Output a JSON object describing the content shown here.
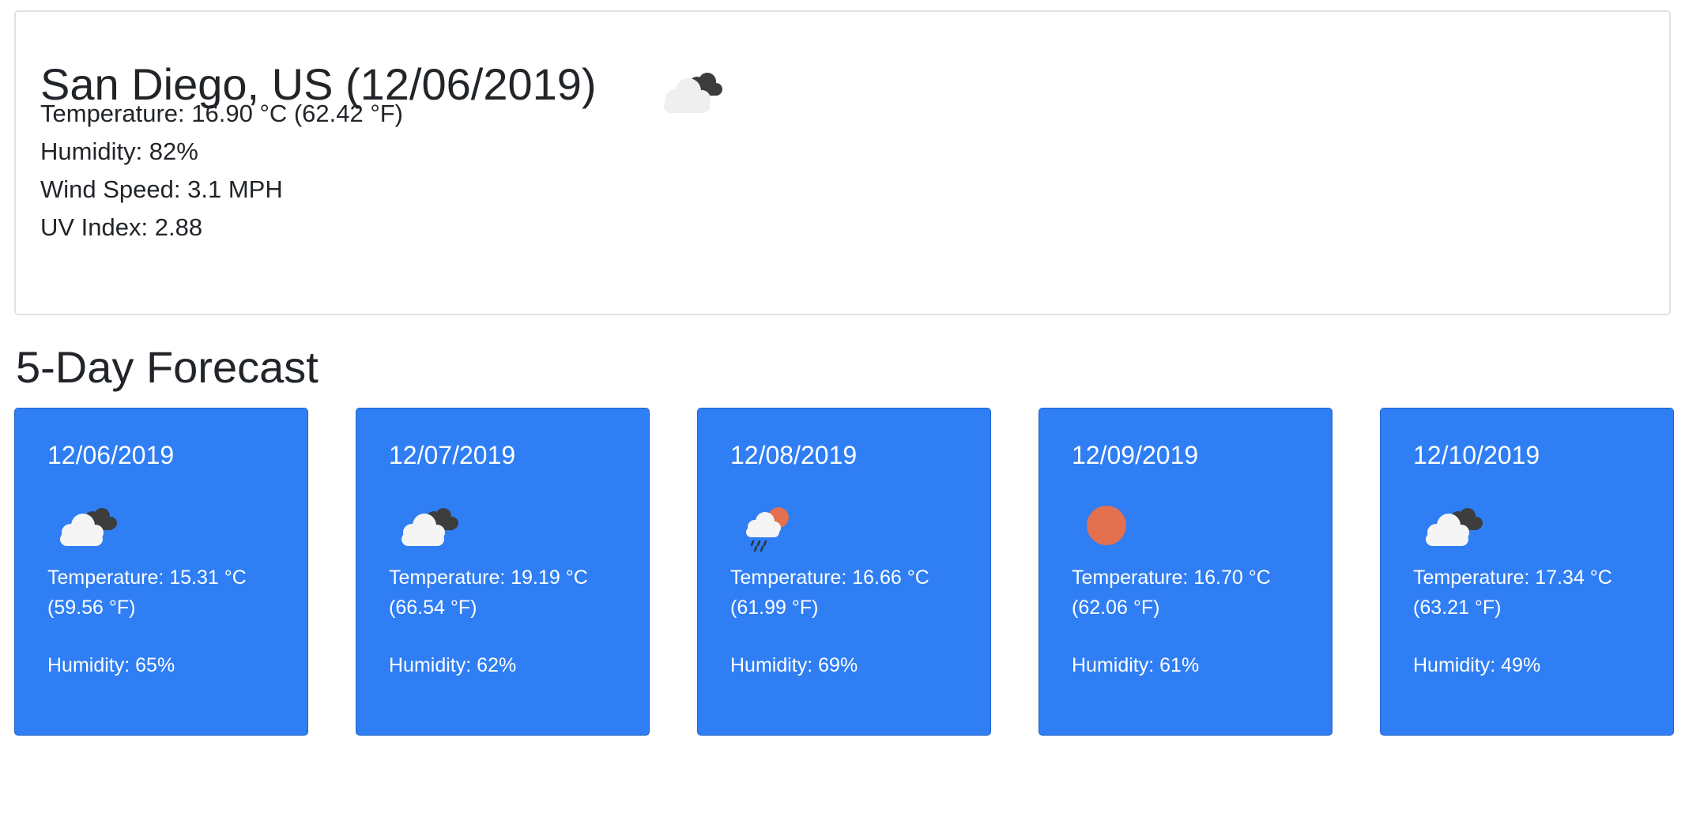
{
  "current": {
    "title": "San Diego, US (12/06/2019)",
    "icon": "cloud-icon",
    "temperature": "Temperature: 16.90 °C (62.42 °F)",
    "humidity": "Humidity: 82%",
    "wind_speed": "Wind Speed: 3.1 MPH",
    "uv_index": "UV Index: 2.88"
  },
  "forecast": {
    "heading": "5-Day Forecast",
    "days": [
      {
        "date": "12/06/2019",
        "icon": "cloud-icon",
        "temp_c": "Temperature: 15.31 °C",
        "temp_f": "(59.56 °F)",
        "humidity": "Humidity: 65%"
      },
      {
        "date": "12/07/2019",
        "icon": "cloud-icon",
        "temp_c": "Temperature: 19.19 °C",
        "temp_f": "(66.54 °F)",
        "humidity": "Humidity: 62%"
      },
      {
        "date": "12/08/2019",
        "icon": "rain-sun-icon",
        "temp_c": "Temperature: 16.66 °C",
        "temp_f": "(61.99 °F)",
        "humidity": "Humidity: 69%"
      },
      {
        "date": "12/09/2019",
        "icon": "sun-icon",
        "temp_c": "Temperature: 16.70 °C",
        "temp_f": "(62.06 °F)",
        "humidity": "Humidity: 61%"
      },
      {
        "date": "12/10/2019",
        "icon": "cloud-icon",
        "temp_c": "Temperature: 17.34 °C",
        "temp_f": "(63.21 °F)",
        "humidity": "Humidity: 49%"
      }
    ]
  },
  "colors": {
    "card_blue": "#2f7ef4",
    "sun": "#e3704e",
    "cloud_light": "#f2f2f2",
    "cloud_dark": "#3d3d3d"
  }
}
